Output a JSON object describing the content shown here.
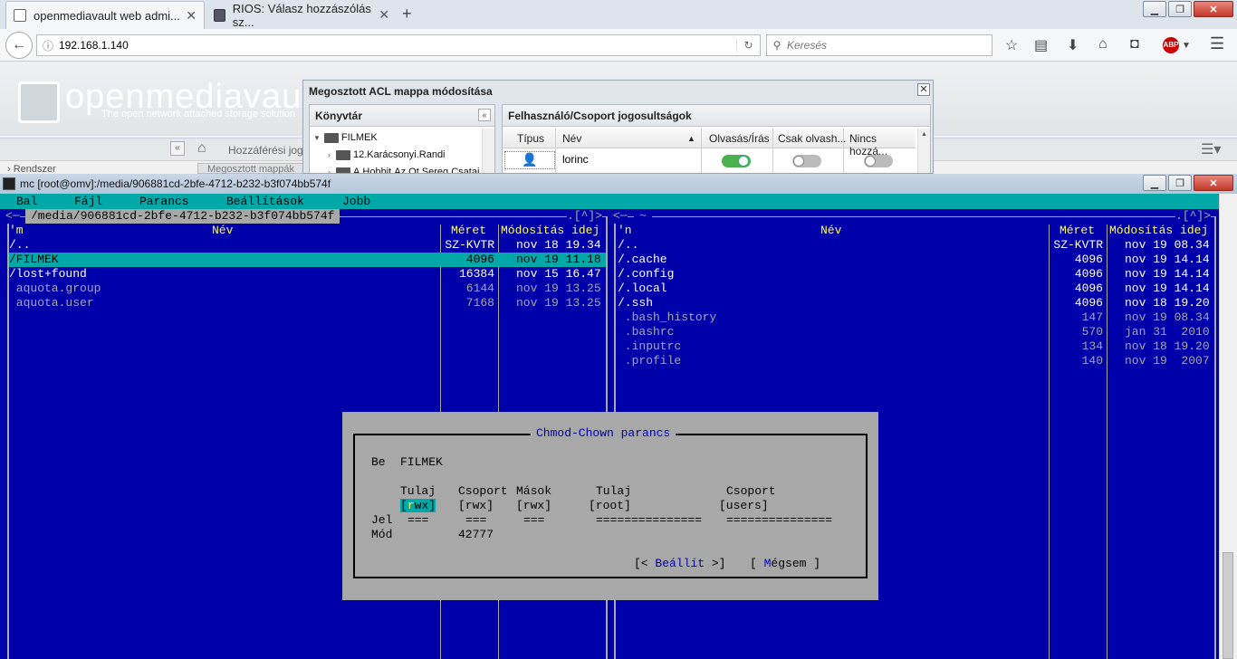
{
  "browser": {
    "tabs": [
      {
        "label": "openmediavault web admi...",
        "active": true
      },
      {
        "label": "RIOS: Válasz hozzászólás sz...",
        "active": false
      }
    ],
    "url": "192.168.1.140",
    "search_placeholder": "Keresés"
  },
  "omv": {
    "logo_text": "openmediavault",
    "tagline": "The open network attached storage solution",
    "breadcrumb": "Hozzáférési jog k",
    "sidebar_item": "Rendszer",
    "tab_peek": "Megosztott mappák"
  },
  "acl_dialog": {
    "title": "Megosztott ACL mappa módosítása",
    "left_header": "Könyvtár",
    "tree": [
      "FILMEK",
      "12.Karácsonyi.Randi",
      "A.Hobbit.Az.Ot.Sereg.Csatai"
    ],
    "right_header": "Felhasználó/Csoport jogosultságok",
    "columns": [
      "Típus",
      "Név",
      "Olvasás/Írás",
      "Csak olvash...",
      "Nincs hozzá..."
    ],
    "rows": [
      {
        "name": "lorinc",
        "read_write": true,
        "read_only": false,
        "no_access": false
      }
    ]
  },
  "mc": {
    "window_title": "mc [root@omv]:/media/906881cd-2bfe-4712-b232-b3f074bb574f",
    "menu": [
      "Bal",
      "Fájl",
      "Parancs",
      "Beállítások",
      "Jobb"
    ],
    "left_panel": {
      "path": "/media/906881cd-2bfe-4712-b232-b3f074bb574f",
      "corner": ".[^]>",
      "head_sort": "'m",
      "head_name": "Név",
      "head_size": "Méret",
      "head_date": "Módosítás idej",
      "files": [
        {
          "name": "/..",
          "size": "SZ-KVTR",
          "date": "nov 18 19.34",
          "dir": true,
          "selected": false
        },
        {
          "name": "/FILMEK",
          "size": "4096",
          "date": "nov 19 11.18",
          "dir": true,
          "selected": true
        },
        {
          "name": "/lost+found",
          "size": "16384",
          "date": "nov 15 16.47",
          "dir": true,
          "selected": false
        },
        {
          "name": " aquota.group",
          "size": "6144",
          "date": "nov 19 13.25",
          "dir": false,
          "selected": false
        },
        {
          "name": " aquota.user",
          "size": "7168",
          "date": "nov 19 13.25",
          "dir": false,
          "selected": false
        }
      ]
    },
    "right_panel": {
      "path": "~",
      "corner": ".[^]>",
      "head_sort": "'n",
      "head_name": "Név",
      "head_size": "Méret",
      "head_date": "Módosítás idej",
      "files": [
        {
          "name": "/..",
          "size": "SZ-KVTR",
          "date": "nov 19 08.34",
          "dir": true
        },
        {
          "name": "/.cache",
          "size": "4096",
          "date": "nov 19 14.14",
          "dir": true
        },
        {
          "name": "/.config",
          "size": "4096",
          "date": "nov 19 14.14",
          "dir": true
        },
        {
          "name": "/.local",
          "size": "4096",
          "date": "nov 19 14.14",
          "dir": true
        },
        {
          "name": "/.ssh",
          "size": "4096",
          "date": "nov 18 19.20",
          "dir": true
        },
        {
          "name": " .bash_history",
          "size": "147",
          "date": "nov 19 08.34",
          "dir": false
        },
        {
          "name": " .bashrc",
          "size": "570",
          "date": "jan 31  2010",
          "dir": false
        },
        {
          "name": " .inputrc",
          "size": "134",
          "date": "nov 18 19.20",
          "dir": false
        },
        {
          "name": " .profile",
          "size": "140",
          "date": "nov 19  2007",
          "dir": false
        }
      ]
    },
    "chmod": {
      "title": "Chmod-Chown parancs",
      "be_label": "Be",
      "target": "FILMEK",
      "col_owner": "Tulaj",
      "col_group": "Csoport",
      "col_others": "Mások",
      "col_owner2": "Tulaj",
      "col_group2": "Csoport",
      "perm_owner_open": "[",
      "perm_owner_hl_r": "r",
      "perm_owner_hl_w": "w",
      "perm_owner_hl_x": "x",
      "perm_owner_close": "]",
      "perm_group": "[rwx]",
      "perm_others": "[rwx]",
      "owner_value": "[root]",
      "group_value": "[users]",
      "jel_label": "Jel",
      "eq_short": "===",
      "eq_long": "===============",
      "mod_label": "Mód",
      "mod_value": "42777",
      "btn_apply_pre": "[< ",
      "btn_apply": "Beállít",
      "btn_apply_post": " >]",
      "btn_cancel_pre": "[ ",
      "btn_cancel_hot": "M",
      "btn_cancel": "égsem",
      "btn_cancel_post": " ]"
    }
  }
}
